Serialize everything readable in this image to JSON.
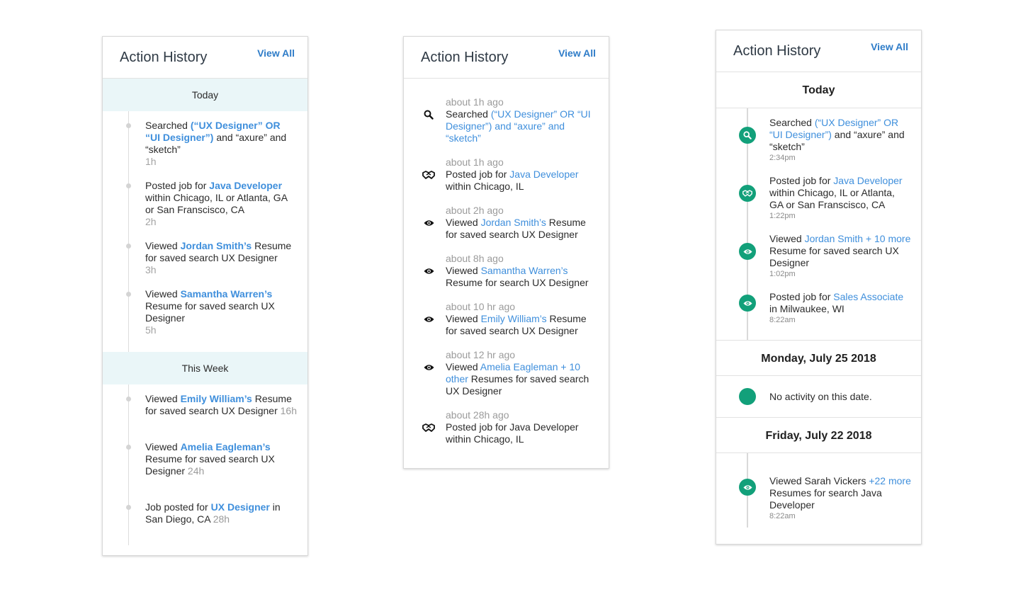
{
  "panel1": {
    "title": "Action History",
    "view_all": "View All",
    "sections": [
      {
        "label": "Today",
        "items": [
          {
            "pre": "Searched ",
            "link": "(“UX Designer” OR “UI Designer”)",
            "post": " and “axure” and “sketch”",
            "time": "1h"
          },
          {
            "pre": "Posted job for ",
            "link": "Java Developer",
            "post": " within Chicago, IL or Atlanta, GA or San Franscisco, CA",
            "time": "2h"
          },
          {
            "pre": "Viewed ",
            "link": "Jordan Smith’s",
            "post": " Resume for saved search UX Designer",
            "time": "3h"
          },
          {
            "pre": "Viewed ",
            "link": "Samantha Warren’s",
            "post": " Resume for saved search UX Designer",
            "time": "5h"
          }
        ]
      },
      {
        "label": "This Week",
        "items": [
          {
            "pre": "Viewed ",
            "link": "Emily William’s",
            "post": " Resume for saved search UX Designer ",
            "time": "16h"
          },
          {
            "pre": "Viewed ",
            "link": "Amelia Eagleman’s",
            "post": " Resume for saved search UX Designer ",
            "time": "24h"
          },
          {
            "pre": "Job posted for ",
            "link": "UX Designer",
            "post": " in San Diego, CA ",
            "time": "28h"
          }
        ]
      }
    ]
  },
  "panel2": {
    "title": "Action History",
    "view_all": "View All",
    "items": [
      {
        "icon": "search-icon",
        "ago": "about 1h ago",
        "pre": "Searched ",
        "link": "(“UX Designer” OR “UI Designer”) and “axure” and “sketch”",
        "post": ""
      },
      {
        "icon": "handshake-icon",
        "ago": "about 1h ago",
        "pre": "Posted job for ",
        "link": "Java Developer",
        "post": " within Chicago, IL"
      },
      {
        "icon": "eye-icon",
        "ago": "about 2h ago",
        "pre": "Viewed ",
        "link": "Jordan Smith’s",
        "post": " Resume for saved search UX Designer"
      },
      {
        "icon": "eye-icon",
        "ago": "about 8h ago",
        "pre": "Viewed ",
        "link": "Samantha Warren’s",
        "post": " Resume for search UX Designer"
      },
      {
        "icon": "eye-icon",
        "ago": "about 10 hr ago",
        "pre": "Viewed ",
        "link": "Emily William’s",
        "post": " Resume for saved search UX Designer"
      },
      {
        "icon": "eye-icon",
        "ago": "about 12 hr ago",
        "pre": "Viewed ",
        "link": "Amelia Eagleman + 10 other",
        "post": " Resumes for saved search UX Designer"
      },
      {
        "icon": "handshake-icon",
        "ago": "about 28h ago",
        "pre": "Posted job for Java Developer within Chicago, IL",
        "link": "",
        "post": ""
      }
    ]
  },
  "panel3": {
    "title": "Action History",
    "view_all": "View All",
    "accent_color": "#12a07a",
    "sections": [
      {
        "label": "Today",
        "items": [
          {
            "icon": "search-icon",
            "pre": "Searched ",
            "link": "(“UX Designer” OR “UI Designer”)",
            "post": " and “axure” and “sketch”",
            "time": "2:34pm"
          },
          {
            "icon": "handshake-icon",
            "pre": "Posted job for ",
            "link": "Java Developer",
            "post": " within Chicago, IL or Atlanta, GA or San Franscisco, CA",
            "time": "1:22pm"
          },
          {
            "icon": "eye-icon",
            "pre": "Viewed ",
            "link": "Jordan Smith + 10 more",
            "post": " Resume for saved search UX Designer",
            "time": "1:02pm"
          },
          {
            "icon": "eye-icon",
            "pre": "Posted job for ",
            "link": "Sales Associate",
            "post": " in Milwaukee, WI",
            "time": "8:22am"
          }
        ]
      },
      {
        "label": "Monday, July 25 2018",
        "empty_text": "No activity on this date."
      },
      {
        "label": "Friday, July 22 2018",
        "items": [
          {
            "icon": "eye-icon",
            "pre": "Viewed Sarah Vickers ",
            "link": "+22 more",
            "post": " Resumes for search Java Developer",
            "time": "8:22am"
          }
        ]
      }
    ]
  }
}
